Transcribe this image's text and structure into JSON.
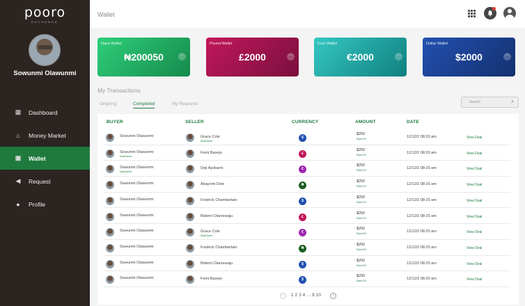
{
  "brand": {
    "name": "pooro",
    "tagline": "EXCHANGE"
  },
  "user": {
    "name": "Sowunmi Olawunmi"
  },
  "nav": [
    {
      "label": "Dashboard",
      "icon": "dashboard-icon"
    },
    {
      "label": "Money Market",
      "icon": "bank-icon"
    },
    {
      "label": "Wallet",
      "icon": "wallet-icon",
      "active": true
    },
    {
      "label": "Request",
      "icon": "megaphone-icon"
    },
    {
      "label": "Profile",
      "icon": "profile-icon"
    }
  ],
  "header": {
    "title": "Wallet"
  },
  "wallets": [
    {
      "label": "Naira Wallet",
      "amount": "₦200050",
      "more": "···"
    },
    {
      "label": "Pound Wallet",
      "amount": "£2000",
      "more": "···"
    },
    {
      "label": "Euro Wallet",
      "amount": "€2000",
      "more": "···"
    },
    {
      "label": "Dollar Wallet",
      "amount": "$2000",
      "more": "···"
    }
  ],
  "transactions": {
    "title": "My Transactions",
    "tabs": [
      "Ongoing",
      "Completed",
      "My Requests"
    ],
    "active_tab": "Completed",
    "search_placeholder": "Search",
    "columns": [
      "BUYER",
      "SELLER",
      "CURRENCY",
      "AMOUNT",
      "DATE"
    ],
    "rows": [
      {
        "buyer": "Sowunmi Olawunmi",
        "buyer_sub": "",
        "seller": "Grace Cole",
        "seller_sub": "DealOwner",
        "currency": "$",
        "currency_color": "#2251b0",
        "amount": "$250",
        "rate": "Rate 570",
        "date": "12/12/2 08:20 am",
        "action": "View Deal"
      },
      {
        "buyer": "Sowunmi Olawunmi",
        "buyer_sub": "DealOwner",
        "seller": "Femi Baoejo",
        "seller_sub": "",
        "currency": "£",
        "currency_color": "#c2185b",
        "amount": "$250",
        "rate": "Rate 570",
        "date": "12/12/2 08:20 am",
        "action": "View Deal"
      },
      {
        "buyer": "Sowunmi Olawunmi",
        "buyer_sub": "DealOwner",
        "seller": "Deji Ayobami",
        "seller_sub": "",
        "currency": "€",
        "currency_color": "#9c27b0",
        "amount": "$250",
        "rate": "Rate 570",
        "date": "12/12/2 08:20 am",
        "action": "View Deal"
      },
      {
        "buyer": "Sowunmi Olawunmi",
        "buyer_sub": "",
        "seller": "Abayomi Dele",
        "seller_sub": "",
        "currency": "₦",
        "currency_color": "#1b5e20",
        "amount": "$250",
        "rate": "Rate 570",
        "date": "12/12/2 08:20 am",
        "action": "View Deal"
      },
      {
        "buyer": "Sowunmi Olawunmi",
        "buyer_sub": "",
        "seller": "Fredrick Chamberlain",
        "seller_sub": "",
        "currency": "$",
        "currency_color": "#2251b0",
        "amount": "$250",
        "rate": "Rate 570",
        "date": "12/12/2 08:20 am",
        "action": "View Deal"
      },
      {
        "buyer": "Sowunmi Olawunmi",
        "buyer_sub": "",
        "seller": "Bidemi Olanrewaju",
        "seller_sub": "",
        "currency": "£",
        "currency_color": "#c2185b",
        "amount": "$250",
        "rate": "Rate 570",
        "date": "12/12/2 08:20 am",
        "action": "View Deal"
      },
      {
        "buyer": "Sowunmi Olawunmi",
        "buyer_sub": "",
        "seller": "Grace Cole",
        "seller_sub": "DealOwner",
        "currency": "€",
        "currency_color": "#9c27b0",
        "amount": "$250",
        "rate": "Rate 570",
        "date": "12/12/2 08:20 am",
        "action": "View Deal"
      },
      {
        "buyer": "Sowunmi Olawunmi",
        "buyer_sub": "",
        "seller": "Fredrick Chamberlain",
        "seller_sub": "",
        "currency": "₦",
        "currency_color": "#1b5e20",
        "amount": "$250",
        "rate": "Rate 570",
        "date": "12/12/2 08:20 am",
        "action": "View Deal"
      },
      {
        "buyer": "Sowunmi Olawunmi",
        "buyer_sub": "",
        "seller": "Bidemi Olanrewaju",
        "seller_sub": "",
        "currency": "$",
        "currency_color": "#2251b0",
        "amount": "$250",
        "rate": "Rate 570",
        "date": "12/12/2 08:20 am",
        "action": "View Deal"
      },
      {
        "buyer": "Sowunmi Olawunmi",
        "buyer_sub": "",
        "seller": "Femi Baoejo",
        "seller_sub": "",
        "currency": "$",
        "currency_color": "#2251b0",
        "amount": "$250",
        "rate": "Rate 570",
        "date": "12/12/2 08:20 am",
        "action": "View Deal"
      }
    ]
  },
  "pagination": {
    "prev": "‹",
    "pages": "1 2 3 4 ... 9 10",
    "next": "›"
  }
}
